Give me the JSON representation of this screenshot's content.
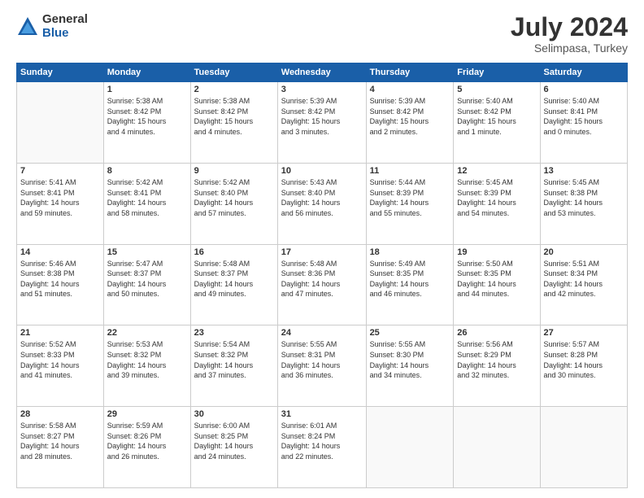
{
  "header": {
    "logo": {
      "general": "General",
      "blue": "Blue"
    },
    "title": "July 2024",
    "location": "Selimpasa, Turkey"
  },
  "days_of_week": [
    "Sunday",
    "Monday",
    "Tuesday",
    "Wednesday",
    "Thursday",
    "Friday",
    "Saturday"
  ],
  "weeks": [
    [
      {
        "day": "",
        "info": ""
      },
      {
        "day": "1",
        "info": "Sunrise: 5:38 AM\nSunset: 8:42 PM\nDaylight: 15 hours\nand 4 minutes."
      },
      {
        "day": "2",
        "info": "Sunrise: 5:38 AM\nSunset: 8:42 PM\nDaylight: 15 hours\nand 4 minutes."
      },
      {
        "day": "3",
        "info": "Sunrise: 5:39 AM\nSunset: 8:42 PM\nDaylight: 15 hours\nand 3 minutes."
      },
      {
        "day": "4",
        "info": "Sunrise: 5:39 AM\nSunset: 8:42 PM\nDaylight: 15 hours\nand 2 minutes."
      },
      {
        "day": "5",
        "info": "Sunrise: 5:40 AM\nSunset: 8:42 PM\nDaylight: 15 hours\nand 1 minute."
      },
      {
        "day": "6",
        "info": "Sunrise: 5:40 AM\nSunset: 8:41 PM\nDaylight: 15 hours\nand 0 minutes."
      }
    ],
    [
      {
        "day": "7",
        "info": "Sunrise: 5:41 AM\nSunset: 8:41 PM\nDaylight: 14 hours\nand 59 minutes."
      },
      {
        "day": "8",
        "info": "Sunrise: 5:42 AM\nSunset: 8:41 PM\nDaylight: 14 hours\nand 58 minutes."
      },
      {
        "day": "9",
        "info": "Sunrise: 5:42 AM\nSunset: 8:40 PM\nDaylight: 14 hours\nand 57 minutes."
      },
      {
        "day": "10",
        "info": "Sunrise: 5:43 AM\nSunset: 8:40 PM\nDaylight: 14 hours\nand 56 minutes."
      },
      {
        "day": "11",
        "info": "Sunrise: 5:44 AM\nSunset: 8:39 PM\nDaylight: 14 hours\nand 55 minutes."
      },
      {
        "day": "12",
        "info": "Sunrise: 5:45 AM\nSunset: 8:39 PM\nDaylight: 14 hours\nand 54 minutes."
      },
      {
        "day": "13",
        "info": "Sunrise: 5:45 AM\nSunset: 8:38 PM\nDaylight: 14 hours\nand 53 minutes."
      }
    ],
    [
      {
        "day": "14",
        "info": "Sunrise: 5:46 AM\nSunset: 8:38 PM\nDaylight: 14 hours\nand 51 minutes."
      },
      {
        "day": "15",
        "info": "Sunrise: 5:47 AM\nSunset: 8:37 PM\nDaylight: 14 hours\nand 50 minutes."
      },
      {
        "day": "16",
        "info": "Sunrise: 5:48 AM\nSunset: 8:37 PM\nDaylight: 14 hours\nand 49 minutes."
      },
      {
        "day": "17",
        "info": "Sunrise: 5:48 AM\nSunset: 8:36 PM\nDaylight: 14 hours\nand 47 minutes."
      },
      {
        "day": "18",
        "info": "Sunrise: 5:49 AM\nSunset: 8:35 PM\nDaylight: 14 hours\nand 46 minutes."
      },
      {
        "day": "19",
        "info": "Sunrise: 5:50 AM\nSunset: 8:35 PM\nDaylight: 14 hours\nand 44 minutes."
      },
      {
        "day": "20",
        "info": "Sunrise: 5:51 AM\nSunset: 8:34 PM\nDaylight: 14 hours\nand 42 minutes."
      }
    ],
    [
      {
        "day": "21",
        "info": "Sunrise: 5:52 AM\nSunset: 8:33 PM\nDaylight: 14 hours\nand 41 minutes."
      },
      {
        "day": "22",
        "info": "Sunrise: 5:53 AM\nSunset: 8:32 PM\nDaylight: 14 hours\nand 39 minutes."
      },
      {
        "day": "23",
        "info": "Sunrise: 5:54 AM\nSunset: 8:32 PM\nDaylight: 14 hours\nand 37 minutes."
      },
      {
        "day": "24",
        "info": "Sunrise: 5:55 AM\nSunset: 8:31 PM\nDaylight: 14 hours\nand 36 minutes."
      },
      {
        "day": "25",
        "info": "Sunrise: 5:55 AM\nSunset: 8:30 PM\nDaylight: 14 hours\nand 34 minutes."
      },
      {
        "day": "26",
        "info": "Sunrise: 5:56 AM\nSunset: 8:29 PM\nDaylight: 14 hours\nand 32 minutes."
      },
      {
        "day": "27",
        "info": "Sunrise: 5:57 AM\nSunset: 8:28 PM\nDaylight: 14 hours\nand 30 minutes."
      }
    ],
    [
      {
        "day": "28",
        "info": "Sunrise: 5:58 AM\nSunset: 8:27 PM\nDaylight: 14 hours\nand 28 minutes."
      },
      {
        "day": "29",
        "info": "Sunrise: 5:59 AM\nSunset: 8:26 PM\nDaylight: 14 hours\nand 26 minutes."
      },
      {
        "day": "30",
        "info": "Sunrise: 6:00 AM\nSunset: 8:25 PM\nDaylight: 14 hours\nand 24 minutes."
      },
      {
        "day": "31",
        "info": "Sunrise: 6:01 AM\nSunset: 8:24 PM\nDaylight: 14 hours\nand 22 minutes."
      },
      {
        "day": "",
        "info": ""
      },
      {
        "day": "",
        "info": ""
      },
      {
        "day": "",
        "info": ""
      }
    ]
  ]
}
